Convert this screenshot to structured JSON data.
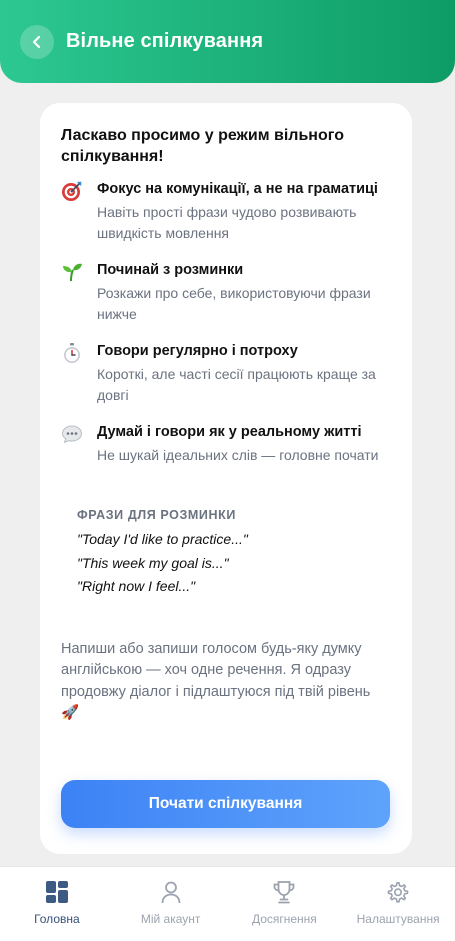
{
  "header": {
    "back_icon": "chevron-left-icon",
    "title": "Вільне спілкування",
    "gradient": [
      "#2dc892",
      "#0e9c66"
    ]
  },
  "card": {
    "title": "Ласкаво просимо у режим вільного спілкування!",
    "tips": [
      {
        "icon": "target-icon",
        "title": "Фокус на комунікації, а не на граматиці",
        "desc": "Навіть прості фрази чудово розвивають швидкість мовлення"
      },
      {
        "icon": "seedling-icon",
        "title": "Починай з розминки",
        "desc": "Розкажи про себе, використовуючи фрази нижче"
      },
      {
        "icon": "stopwatch-icon",
        "title": "Говори регулярно і потроху",
        "desc": "Короткі, але часті сесії працюють краще за довгі"
      },
      {
        "icon": "speech-bubble-icon",
        "title": "Думай і говори як у реальному житті",
        "desc": "Не шукай ідеальних слів — головне почати"
      }
    ],
    "phrases_title": "ФРАЗИ ДЛЯ РОЗМИНКИ",
    "phrases": [
      "\"Today I'd like to practice...\"",
      "\"This week my goal is...\"",
      "\"Right now I feel...\""
    ],
    "invite_text": "Напиши або запиши голосом будь-яку думку англійською — хоч одне речення. Я одразу продовжу діалог і підлаштуюся під твій рівень 🚀",
    "cta_label": "Почати спілкування",
    "cta_colors": [
      "#3d82f5",
      "#5ea3fb"
    ]
  },
  "tabbar": {
    "tabs": [
      {
        "label": "Головна",
        "icon": "home-grid-icon",
        "active": true
      },
      {
        "label": "Мій акаунт",
        "icon": "user-icon",
        "active": false
      },
      {
        "label": "Досягнення",
        "icon": "trophy-icon",
        "active": false
      },
      {
        "label": "Налаштування",
        "icon": "gear-icon",
        "active": false
      }
    ],
    "active_color": "#35507a",
    "inactive_color": "#9ca3af"
  }
}
